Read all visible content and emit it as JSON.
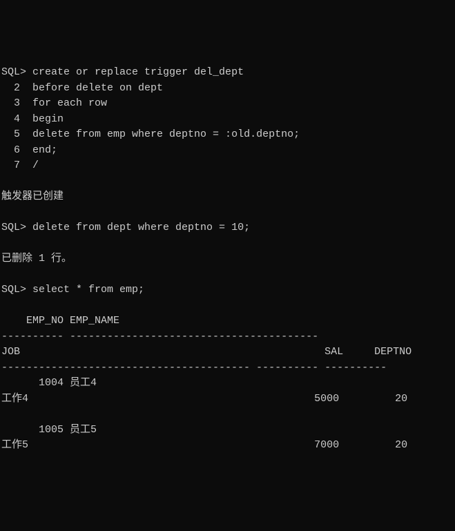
{
  "prompt1": "SQL> ",
  "code_lines": [
    "create or replace trigger del_dept",
    "before delete on dept",
    "for each row",
    "begin",
    "delete from emp where deptno = :old.deptno;",
    "end;",
    "/"
  ],
  "line_nums": [
    "  2  ",
    "  3  ",
    "  4  ",
    "  5  ",
    "  6  ",
    "  7  "
  ],
  "msg_trigger_created": "触发器已创建",
  "prompt2": "SQL> ",
  "stmt_delete": "delete from dept where deptno = 10;",
  "msg_deleted": "已删除 1 行。",
  "prompt3": "SQL> ",
  "stmt_select": "select * from emp;",
  "header1": "    EMP_NO EMP_NAME",
  "sep1": "---------- ----------------------------------------",
  "header2": "JOB                                                 SAL     DEPTNO",
  "sep2": "---------------------------------------- ---------- ----------",
  "row1_line1": "      1004 员工4",
  "row1_line2": "工作4                                              5000         20",
  "row2_line1": "      1005 员工5",
  "row2_line2": "工作5                                              7000         20",
  "chart_data": {
    "type": "table",
    "title": "select * from emp",
    "columns": [
      "EMP_NO",
      "EMP_NAME",
      "JOB",
      "SAL",
      "DEPTNO"
    ],
    "rows": [
      {
        "EMP_NO": 1004,
        "EMP_NAME": "员工4",
        "JOB": "工作4",
        "SAL": 5000,
        "DEPTNO": 20
      },
      {
        "EMP_NO": 1005,
        "EMP_NAME": "员工5",
        "JOB": "工作5",
        "SAL": 7000,
        "DEPTNO": 20
      }
    ]
  }
}
